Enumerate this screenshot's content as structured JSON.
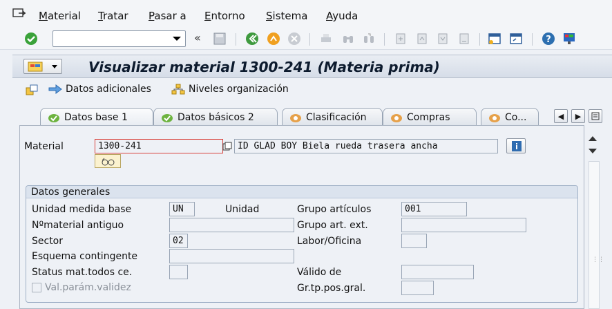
{
  "menu": {
    "items": [
      "Material",
      "Tratar",
      "Pasar a",
      "Entorno",
      "Sistema",
      "Ayuda"
    ]
  },
  "toolbar": {
    "command_field_value": ""
  },
  "title": {
    "text": "Visualizar material 1300-241 (Materia prima)"
  },
  "app_toolbar": {
    "additional_data": "Datos adicionales",
    "org_levels": "Niveles organización"
  },
  "tabs": [
    {
      "label": "Datos base 1",
      "active": true
    },
    {
      "label": "Datos básicos 2",
      "active": false
    },
    {
      "label": "Clasificación",
      "active": false
    },
    {
      "label": "Compras",
      "active": false
    },
    {
      "label": "Co...",
      "active": false
    }
  ],
  "material": {
    "label": "Material",
    "number": "1300-241",
    "description": "ID GLAD BOY Biela rueda trasera ancha"
  },
  "general_data": {
    "title": "Datos generales",
    "base_unit_label": "Unidad medida base",
    "base_unit_value": "UN",
    "base_unit_text": "Unidad",
    "old_material_label": "Nºmaterial antiguo",
    "old_material_value": "",
    "division_label": "Sector",
    "division_value": "02",
    "contingent_label": "Esquema contingente",
    "contingent_value": "",
    "x_plant_status_label": "Status mat.todos ce.",
    "x_plant_status_value": "",
    "validity_params_label": "Val.parám.validez",
    "material_group_label": "Grupo artículos",
    "material_group_value": "001",
    "ext_group_label": "Grupo art. ext.",
    "ext_group_value": "",
    "lab_office_label": "Labor/Oficina",
    "lab_office_value": "",
    "valid_from_label": "Válido de",
    "valid_from_value": "",
    "gen_item_cat_label": "Gr.tp.pos.gral.",
    "gen_item_cat_value": ""
  }
}
